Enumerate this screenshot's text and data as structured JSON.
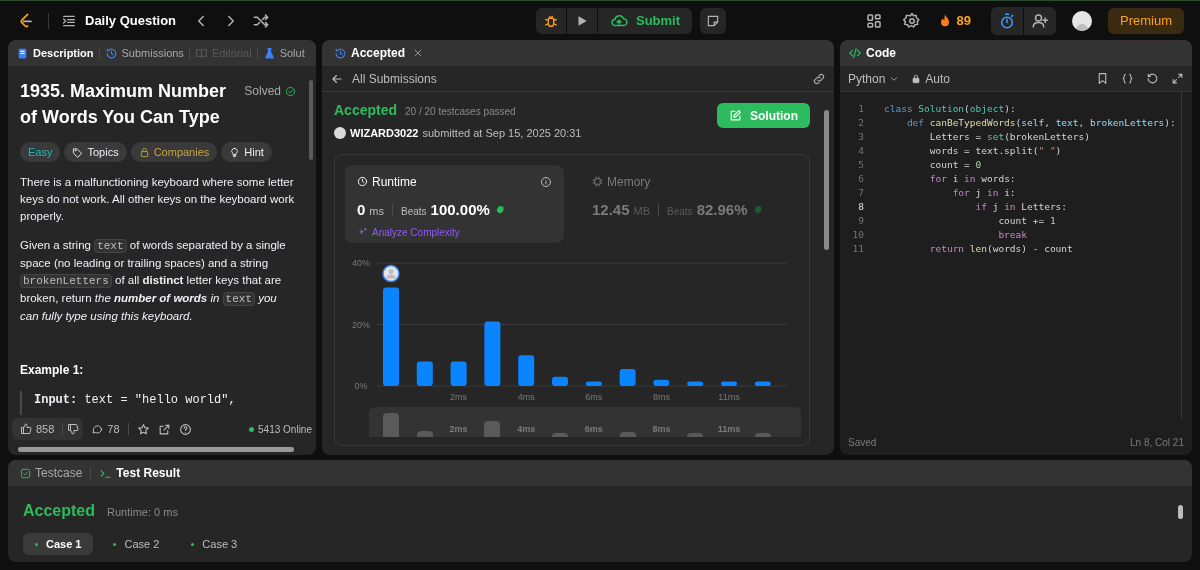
{
  "top_bar": {
    "title": "Daily Question",
    "submit": "Submit",
    "streak": "89",
    "premium": "Premium"
  },
  "description_panel": {
    "tabs": [
      {
        "label": "Description",
        "selected": true,
        "disabled": false,
        "kind": "description"
      },
      {
        "label": "Submissions",
        "selected": false,
        "disabled": false,
        "kind": "submissions"
      },
      {
        "label": "Editorial",
        "selected": false,
        "disabled": true,
        "kind": "editorial"
      },
      {
        "label": "Solut",
        "selected": false,
        "disabled": false,
        "kind": "solutions"
      }
    ],
    "title": "1935. Maximum Number of Words You Can Type",
    "status": "Solved",
    "tags": [
      {
        "label": "Easy",
        "kind": "difficulty"
      },
      {
        "label": "Topics",
        "kind": "topics"
      },
      {
        "label": "Companies",
        "kind": "companies"
      },
      {
        "label": "Hint",
        "kind": "hint"
      }
    ],
    "paragraphs": [
      [
        {
          "kind": "text",
          "text": "There is a malfunctioning keyboard where some letter keys do not work. All other keys on the keyboard work properly."
        }
      ],
      [
        {
          "kind": "text",
          "text": "Given a string "
        },
        {
          "kind": "code",
          "text": "text"
        },
        {
          "kind": "text",
          "text": " of words separated by a single space (no leading or trailing spaces) and a string "
        },
        {
          "kind": "code",
          "text": "brokenLetters"
        },
        {
          "kind": "text",
          "text": " of all **distinct** letter keys that are broken, return "
        },
        {
          "kind": "italic",
          "text": "the **number of words** in "
        },
        {
          "kind": "code",
          "text": "text"
        },
        {
          "kind": "italic",
          "text": " you can fully type using this keyboard."
        }
      ]
    ],
    "example_heading": "Example 1:",
    "example_lines": [
      "**Input:** text = \"hello world\","
    ],
    "footer": {
      "likes": "858",
      "comments": "78",
      "online": "5413 Online"
    }
  },
  "submission_panel": {
    "tab": "Accepted",
    "back_link": "All Submissions",
    "status": "Accepted",
    "testcases": "20 / 20 testcases passed",
    "user": "WIZARD3022",
    "submitted": "submitted at Sep 15, 2025 20:31",
    "solution_button": "Solution",
    "stats": [
      {
        "kind": "runtime",
        "label": "Runtime",
        "value": "0",
        "unit": "ms",
        "beats_label": "Beats",
        "beats": "100.00%",
        "analyze": "Analyze Complexity",
        "selected": true
      },
      {
        "kind": "memory",
        "label": "Memory",
        "value": "12.45",
        "unit": "MB",
        "beats_label": "Beats",
        "beats": "82.96%",
        "selected": false
      }
    ],
    "chart_data": {
      "type": "bar",
      "categories": [
        null,
        null,
        "2ms",
        null,
        "4ms",
        null,
        "6ms",
        null,
        "8ms",
        null,
        "11ms",
        null
      ],
      "series": [
        {
          "color": "#0a84ff",
          "values": [
            32,
            8,
            8,
            21,
            10,
            3,
            1.5,
            5.5,
            2,
            1.5,
            1.5,
            1.5
          ]
        }
      ],
      "ylim": [
        0,
        40
      ],
      "yticks": [
        {
          "value": 0,
          "label": "0%"
        },
        {
          "value": 20,
          "label": "20%"
        },
        {
          "value": 40,
          "label": "40%"
        }
      ]
    },
    "overview_labels": [
      "2ms",
      "4ms",
      "6ms",
      "8ms",
      "11ms"
    ]
  },
  "code_panel": {
    "title": "Code",
    "language": "Python",
    "mode": "Auto",
    "status": "Saved",
    "cursor": "Ln 8, Col 21",
    "lines": [
      {
        "number": "1",
        "selected": false,
        "tokens": [
          {
            "kind": "keyword",
            "text": "class "
          },
          {
            "kind": "type",
            "text": "Solution"
          },
          {
            "kind": "plain",
            "text": "("
          },
          {
            "kind": "type",
            "text": "object"
          },
          {
            "kind": "plain",
            "text": "):"
          }
        ]
      },
      {
        "number": "2",
        "selected": false,
        "tokens": [
          {
            "kind": "keyword",
            "text": "    def "
          },
          {
            "kind": "function",
            "text": "canBeTypedWords"
          },
          {
            "kind": "plain",
            "text": "("
          },
          {
            "kind": "variable",
            "text": "self"
          },
          {
            "kind": "plain",
            "text": ", "
          },
          {
            "kind": "variable",
            "text": "text"
          },
          {
            "kind": "plain",
            "text": ", "
          },
          {
            "kind": "variable",
            "text": "brokenLetters"
          },
          {
            "kind": "plain",
            "text": "):"
          }
        ]
      },
      {
        "number": "3",
        "selected": false,
        "tokens": [
          {
            "kind": "plain",
            "text": "        Letters = "
          },
          {
            "kind": "type",
            "text": "set"
          },
          {
            "kind": "plain",
            "text": "(brokenLetters)"
          }
        ]
      },
      {
        "number": "4",
        "selected": false,
        "tokens": [
          {
            "kind": "plain",
            "text": "        words = text.split("
          },
          {
            "kind": "string",
            "text": "\" \""
          },
          {
            "kind": "plain",
            "text": ")"
          }
        ]
      },
      {
        "number": "5",
        "selected": false,
        "tokens": [
          {
            "kind": "plain",
            "text": "        count = "
          },
          {
            "kind": "number",
            "text": "0"
          }
        ]
      },
      {
        "number": "6",
        "selected": false,
        "tokens": [
          {
            "kind": "control",
            "text": "        for"
          },
          {
            "kind": "plain",
            "text": " i "
          },
          {
            "kind": "control",
            "text": "in"
          },
          {
            "kind": "plain",
            "text": " words:"
          }
        ]
      },
      {
        "number": "7",
        "selected": false,
        "tokens": [
          {
            "kind": "control",
            "text": "            for"
          },
          {
            "kind": "plain",
            "text": " j "
          },
          {
            "kind": "control",
            "text": "in"
          },
          {
            "kind": "plain",
            "text": " i:"
          }
        ]
      },
      {
        "number": "8",
        "selected": true,
        "tokens": [
          {
            "kind": "control",
            "text": "                if"
          },
          {
            "kind": "plain",
            "text": " j "
          },
          {
            "kind": "control",
            "text": "in"
          },
          {
            "kind": "plain",
            "text": " Letters:"
          }
        ]
      },
      {
        "number": "9",
        "selected": false,
        "tokens": [
          {
            "kind": "plain",
            "text": "                    count += "
          },
          {
            "kind": "number",
            "text": "1"
          }
        ]
      },
      {
        "number": "10",
        "selected": false,
        "tokens": [
          {
            "kind": "control",
            "text": "                    break"
          }
        ]
      },
      {
        "number": "11",
        "selected": false,
        "tokens": [
          {
            "kind": "control",
            "text": "        return "
          },
          {
            "kind": "function",
            "text": "len"
          },
          {
            "kind": "plain",
            "text": "(words) - count"
          }
        ]
      }
    ]
  },
  "test_panel": {
    "tabs": [
      {
        "label": "Testcase",
        "selected": false,
        "kind": "testcase"
      },
      {
        "label": "Test Result",
        "selected": true,
        "kind": "result"
      }
    ],
    "status": "Accepted",
    "runtime": "Runtime: 0 ms",
    "cases": [
      {
        "label": "Case 1",
        "selected": true
      },
      {
        "label": "Case 2",
        "selected": false
      },
      {
        "label": "Case 3",
        "selected": false
      }
    ]
  }
}
